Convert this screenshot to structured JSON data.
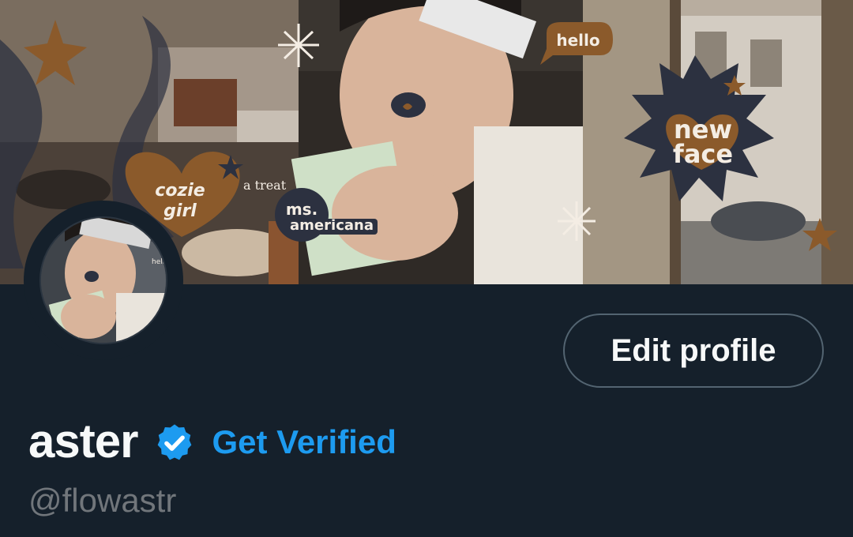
{
  "banner": {
    "stickers": {
      "hello": "hello",
      "cozie_line1": "cozie",
      "cozie_line2": "girl",
      "treat": "a treat",
      "ms_line1": "ms.",
      "ms_line2": "americana",
      "new_line1": "new",
      "new_line2": "face",
      "avatar_mini": "hello"
    },
    "colors": {
      "brown": "#8b5a2b",
      "navy": "#2c3140",
      "cream": "#f4ede4"
    }
  },
  "profile": {
    "edit_button": "Edit profile",
    "display_name": "aster",
    "get_verified": "Get Verified",
    "handle": "@flowastr",
    "verified_icon": "verified-badge-icon"
  },
  "colors": {
    "background": "#15202b",
    "accent": "#1d9bf0",
    "text_primary": "#f7f9f9",
    "text_secondary": "#71767b",
    "border": "#536471"
  }
}
